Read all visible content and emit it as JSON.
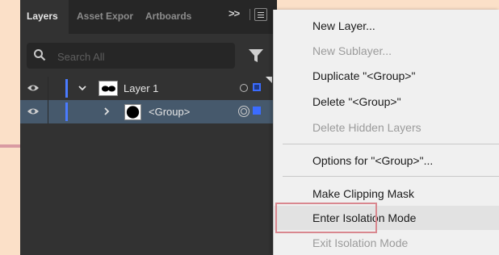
{
  "panel": {
    "tabs": [
      "Layers",
      "Asset Expor",
      "Artboards"
    ],
    "overflow_label": ">>",
    "search": {
      "placeholder": "Search All",
      "value": ""
    },
    "layers": [
      {
        "label": "Layer 1",
        "expanded": true,
        "color": "#4a7bff"
      },
      {
        "label": "<Group>",
        "expanded": false,
        "selected": true,
        "color": "#4a7bff"
      }
    ]
  },
  "context_menu": {
    "items": [
      {
        "label": "New Layer...",
        "disabled": false
      },
      {
        "label": "New Sublayer...",
        "disabled": true
      },
      {
        "label": "Duplicate \"<Group>\"",
        "disabled": false
      },
      {
        "label": "Delete \"<Group>\"",
        "disabled": false
      },
      {
        "label": "Delete Hidden Layers",
        "disabled": true
      },
      {
        "label": "Options for \"<Group>\"...",
        "disabled": false
      },
      {
        "label": "Make Clipping Mask",
        "disabled": false
      },
      {
        "label": "Enter Isolation Mode",
        "disabled": false,
        "highlighted": true
      },
      {
        "label": "Exit Isolation Mode",
        "disabled": true
      }
    ]
  },
  "colors": {
    "selection_row": "#46596c",
    "layer_color": "#4a7bff",
    "highlight_outline": "#d9878f"
  }
}
